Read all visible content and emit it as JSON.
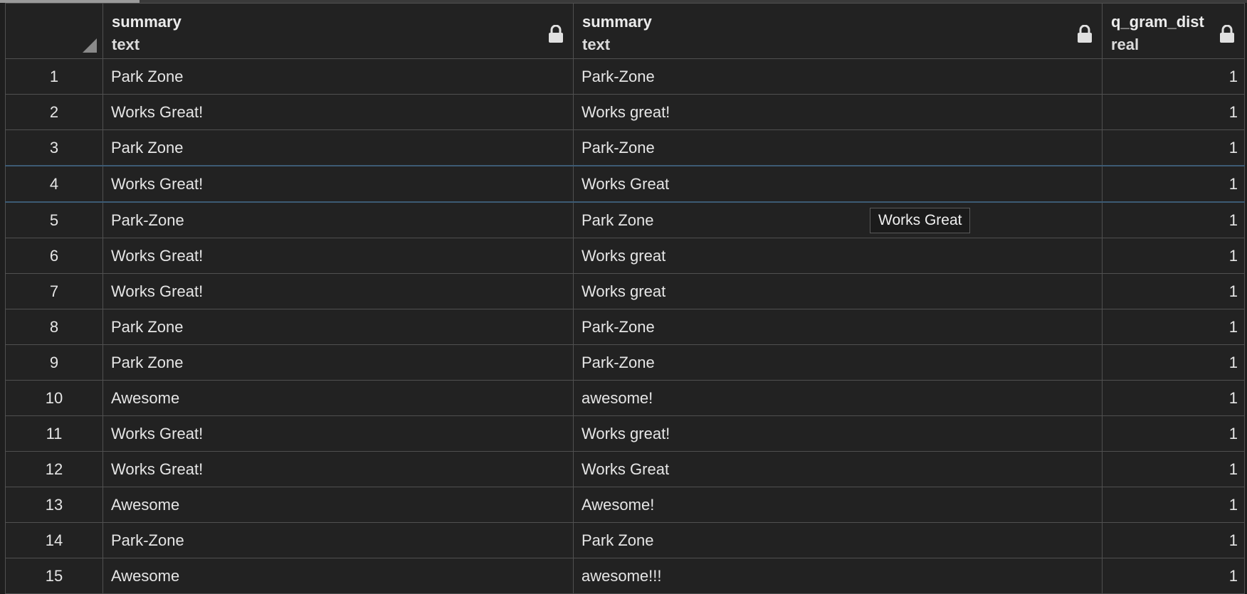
{
  "columns": [
    {
      "name": "summary",
      "type": "text"
    },
    {
      "name": "summary",
      "type": "text"
    },
    {
      "name": "q_gram_dist",
      "type": "real"
    }
  ],
  "rows": [
    {
      "n": "1",
      "a": "Park Zone",
      "b": "Park-Zone",
      "d": "1"
    },
    {
      "n": "2",
      "a": "Works Great!",
      "b": "Works great!",
      "d": "1"
    },
    {
      "n": "3",
      "a": "Park Zone",
      "b": "Park-Zone",
      "d": "1"
    },
    {
      "n": "4",
      "a": "Works Great!",
      "b": "Works Great",
      "d": "1"
    },
    {
      "n": "5",
      "a": "Park-Zone",
      "b": "Park Zone",
      "d": "1"
    },
    {
      "n": "6",
      "a": "Works Great!",
      "b": "Works great",
      "d": "1"
    },
    {
      "n": "7",
      "a": "Works Great!",
      "b": "Works great",
      "d": "1"
    },
    {
      "n": "8",
      "a": "Park Zone",
      "b": "Park-Zone",
      "d": "1"
    },
    {
      "n": "9",
      "a": "Park Zone",
      "b": "Park-Zone",
      "d": "1"
    },
    {
      "n": "10",
      "a": "Awesome",
      "b": "awesome!",
      "d": "1"
    },
    {
      "n": "11",
      "a": "Works Great!",
      "b": "Works great!",
      "d": "1"
    },
    {
      "n": "12",
      "a": "Works Great!",
      "b": "Works Great",
      "d": "1"
    },
    {
      "n": "13",
      "a": "Awesome",
      "b": "Awesome!",
      "d": "1"
    },
    {
      "n": "14",
      "a": "Park-Zone",
      "b": "Park Zone",
      "d": "1"
    },
    {
      "n": "15",
      "a": "Awesome",
      "b": "awesome!!!",
      "d": "1"
    }
  ],
  "tooltip": {
    "text": "Works Great"
  },
  "icons": {
    "lock": "lock-icon",
    "corner": "select-all-corner-icon"
  },
  "colors": {
    "background": "#222222",
    "grid_line": "#505050",
    "selected_row_border": "#3d5b74"
  }
}
